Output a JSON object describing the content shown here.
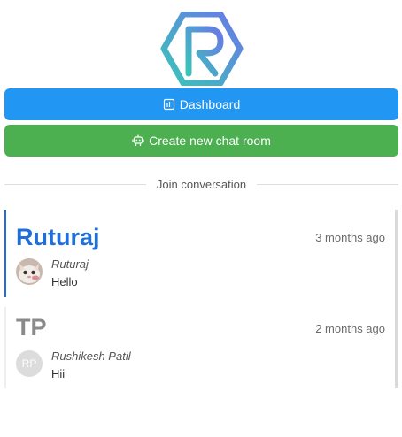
{
  "brand": {
    "logo_icon": "hexagon-r-logo-icon",
    "gradient_start": "#38c6b8",
    "gradient_end": "#6a78e8"
  },
  "actions": {
    "dashboard_label": "Dashboard",
    "dashboard_icon": "chart-icon",
    "create_room_label": "Create new chat room",
    "create_room_icon": "robot-icon"
  },
  "divider": {
    "label": "Join conversation"
  },
  "rooms": [
    {
      "title": "Ruturaj",
      "time": "3 months ago",
      "last_sender": "Ruturaj",
      "last_message": "Hello",
      "avatar": "cat-avatar-photo",
      "active": true
    },
    {
      "title": "TP",
      "time": "2 months ago",
      "last_sender": "Rushikesh Patil",
      "last_message": "Hii",
      "avatar_initials": "RP",
      "active": false
    }
  ],
  "colors": {
    "primary": "#2196f3",
    "success": "#4caf50",
    "active_room": "#1e6fd9",
    "inactive_room": "#8a8a8a"
  }
}
